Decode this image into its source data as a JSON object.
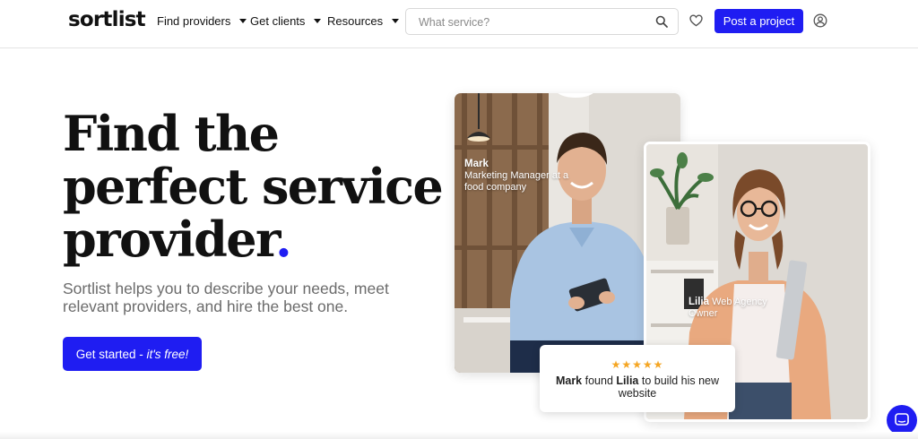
{
  "header": {
    "logo": "sortlist",
    "nav": [
      {
        "label": "Find providers"
      },
      {
        "label": "Get clients"
      },
      {
        "label": "Resources"
      }
    ],
    "search_placeholder": "What service?",
    "post_project_label": "Post a project",
    "icons": [
      "search-icon",
      "heart-icon",
      "user-icon"
    ]
  },
  "hero": {
    "title_line1": "Find the",
    "title_line2": "perfect service",
    "title_line3": "provider",
    "title_dot": ".",
    "subtitle": "Sortlist helps you to describe your needs, meet relevant providers, and hire the best one.",
    "cta_main": "Get started - ",
    "cta_em": "it's free!"
  },
  "cards": {
    "mark_name": "Mark",
    "mark_role": "Marketing Manager at a food company",
    "lilia_name": "Lilia",
    "lilia_role": "Web Agency Owner"
  },
  "review": {
    "stars": "★★★★★",
    "name1": "Mark",
    "word_found": " found ",
    "name2": "Lilia",
    "rest": " to build his new website"
  },
  "colors": {
    "accent": "#1f1df2",
    "star": "#f5a623"
  }
}
